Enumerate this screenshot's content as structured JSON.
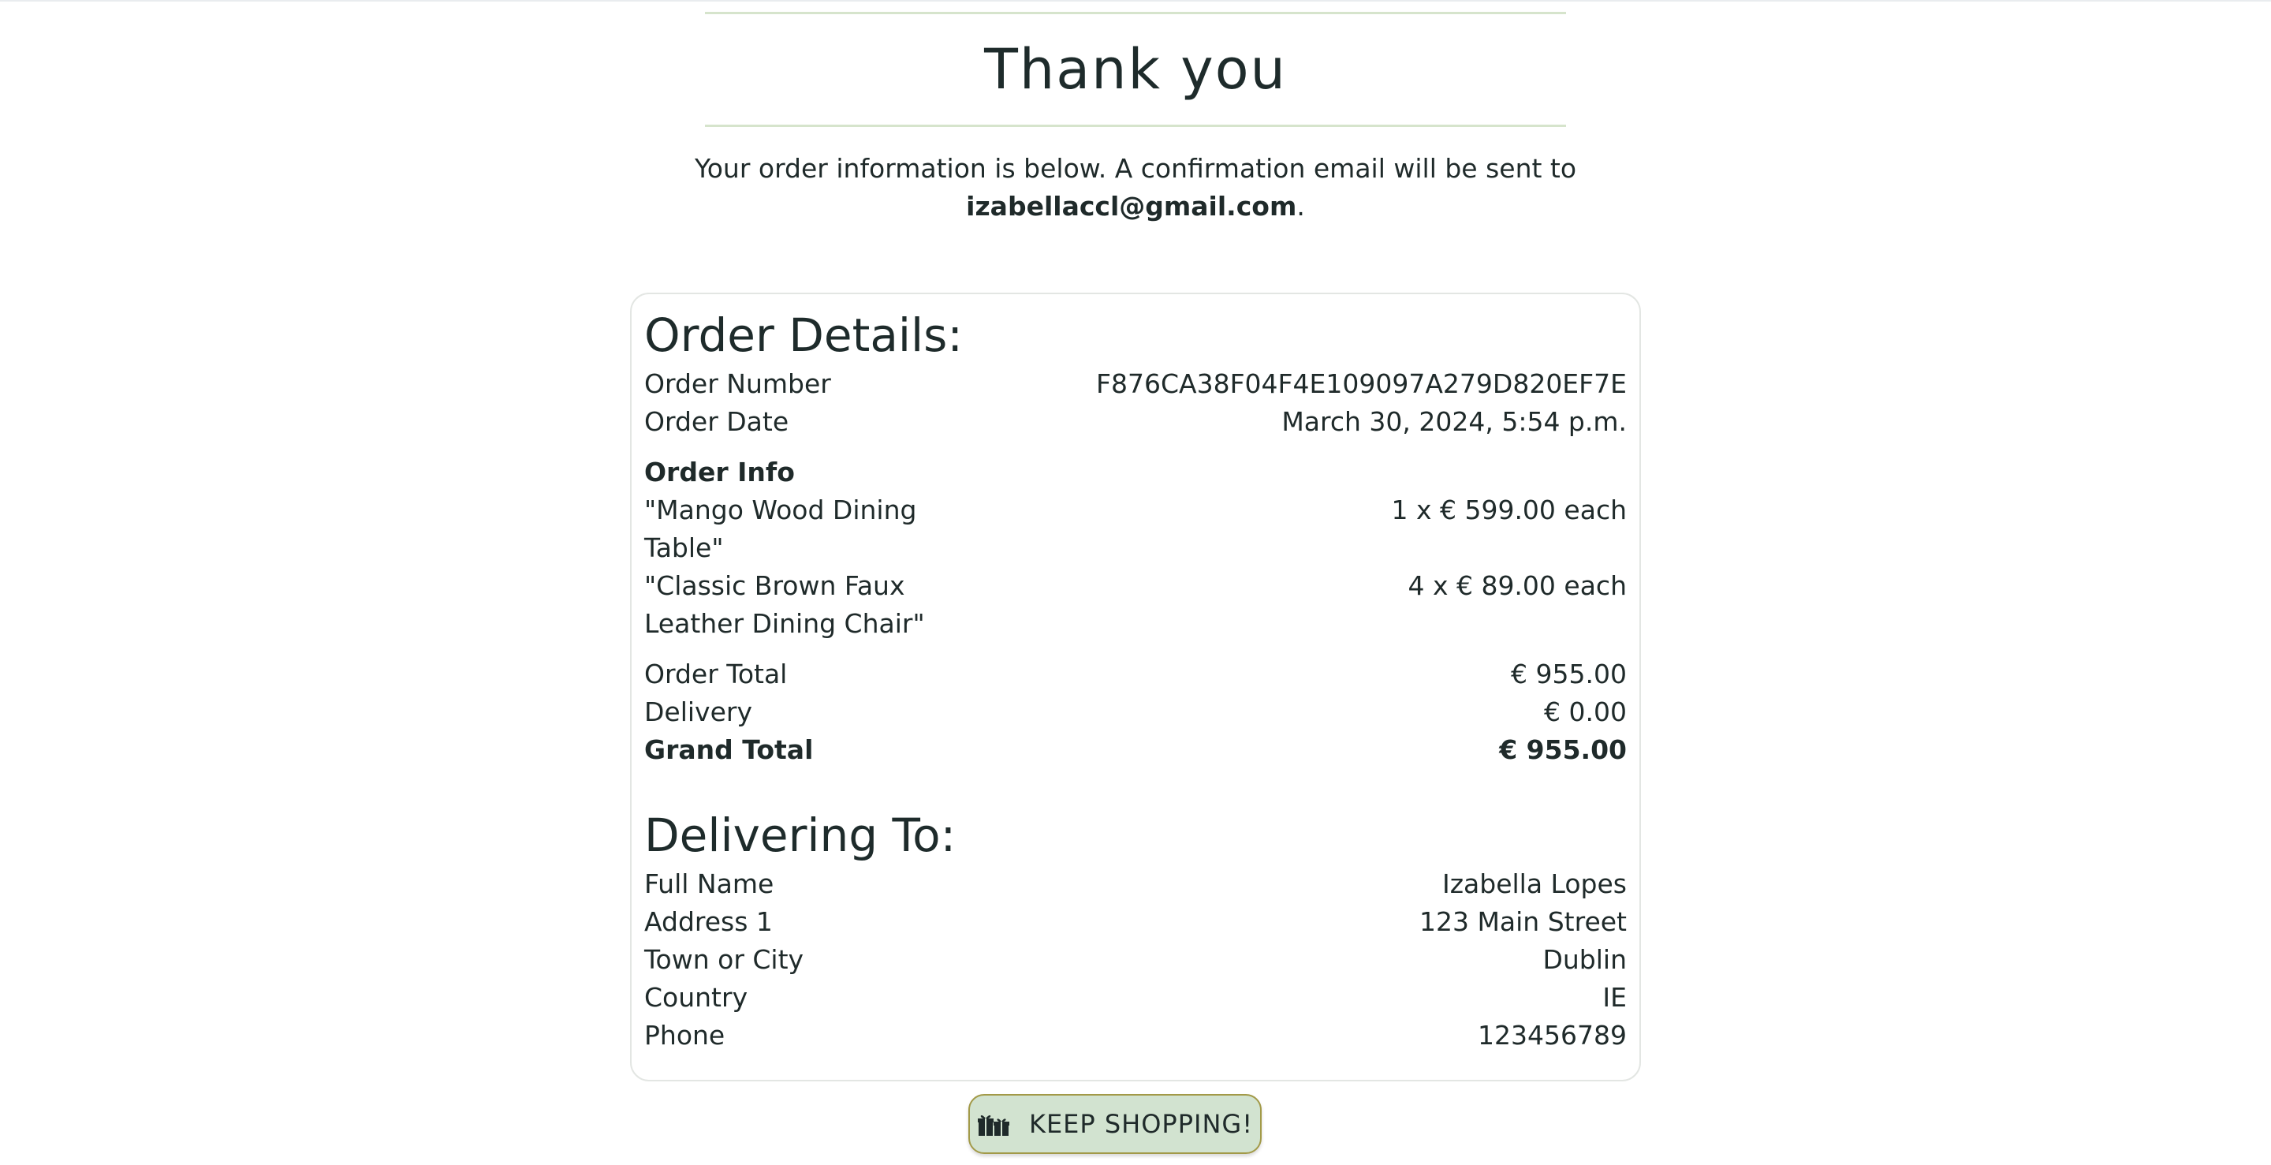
{
  "hero": {
    "title": "Thank you"
  },
  "intro": {
    "text": "Your order information is below. A confirmation email will be sent to",
    "email": "izabellaccl@gmail.com",
    "punct": "."
  },
  "order_details": {
    "title": "Order Details:",
    "rows": [
      {
        "label": "Order Number",
        "value": "F876CA38F04F4E109097A279D820EF7E"
      },
      {
        "label": "Order Date",
        "value": "March 30, 2024, 5:54 p.m."
      }
    ],
    "info_heading": "Order Info",
    "items": [
      {
        "name": "\"Mango Wood Dining Table\"",
        "qty_price": "1 x € 599.00 each"
      },
      {
        "name": "\"Classic Brown Faux Leather Dining Chair\"",
        "qty_price": "4 x € 89.00 each"
      }
    ],
    "totals": [
      {
        "label": "Order Total",
        "value": "€ 955.00"
      },
      {
        "label": "Delivery",
        "value": "€ 0.00"
      }
    ],
    "grand_total": {
      "label": "Grand Total",
      "value": "€ 955.00"
    }
  },
  "delivery": {
    "title": "Delivering To:",
    "rows": [
      {
        "label": "Full Name",
        "value": "Izabella Lopes"
      },
      {
        "label": "Address 1",
        "value": "123 Main Street"
      },
      {
        "label": "Town or City",
        "value": "Dublin"
      },
      {
        "label": "Country",
        "value": "IE"
      },
      {
        "label": "Phone",
        "value": "123456789"
      }
    ]
  },
  "keep_shopping": {
    "label": "KEEP SHOPPING!",
    "icon": "gifts-icon"
  },
  "colors": {
    "rule": "#d6e4cc",
    "button_bg": "#d2e3d0",
    "button_border": "#a29a48",
    "text": "#1f2a2a"
  }
}
